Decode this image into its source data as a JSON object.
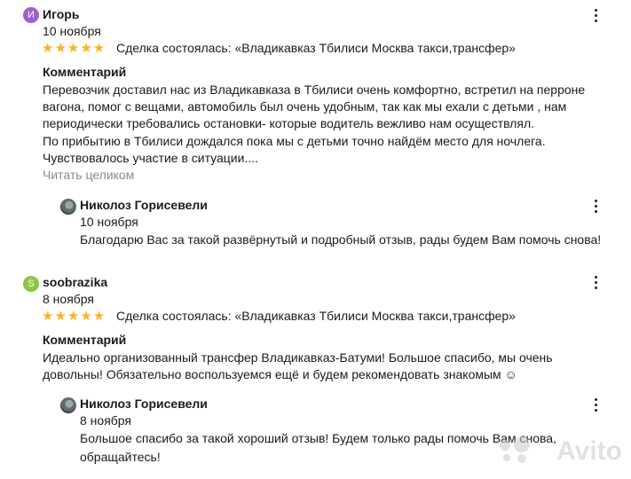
{
  "reviews": [
    {
      "author": "Игорь",
      "avatar_letter": "И",
      "avatar_color": "#a25ed1",
      "date": "10 ноября",
      "stars": "★★★★★",
      "rating": 5,
      "deal": "Сделка состоялась: «Владикавказ Тбилиси Москва такси,трансфер»",
      "comment_heading": "Комментарий",
      "comment": "Перевозчик доставил нас из Владикавказа в Тбилиси очень комфортно, встретил на перроне\nвагона, помог с вещами, автомобиль был очень удобным, так как мы ехали с детьми , нам\nпериодически требовались остановки- которые водитель вежливо нам осуществлял.\nПо прибытию в Тбилиси дождался пока мы с детьми точно найдём место для ночлега.\nЧувствовалось участие в ситуации....",
      "show_more": "Читать целиком",
      "reply": {
        "author": "Николоз Горисевели",
        "date": "10 ноября",
        "text": "Благодарю Вас за такой развёрнутый и подробный отзыв, рады будем Вам помочь снова!"
      }
    },
    {
      "author": "soobrazika",
      "avatar_letter": "S",
      "avatar_color": "#8cc63f",
      "date": "8 ноября",
      "stars": "★★★★★",
      "rating": 5,
      "deal": "Сделка состоялась: «Владикавказ Тбилиси Москва такси,трансфер»",
      "comment_heading": "Комментарий",
      "comment": "Идеально организованный трансфер Владикавказ-Батуми! Большое спасибо, мы очень\nдовольны! Обязательно воспользуемся ещё и будем рекомендовать знакомым ☺",
      "reply": {
        "author": "Николоз Горисевели",
        "date": "8 ноября",
        "text": "Большое спасибо за такой хороший отзыв! Будем только рады помочь Вам снова,\nобращайтесь!"
      }
    }
  ],
  "watermark": "Avito"
}
